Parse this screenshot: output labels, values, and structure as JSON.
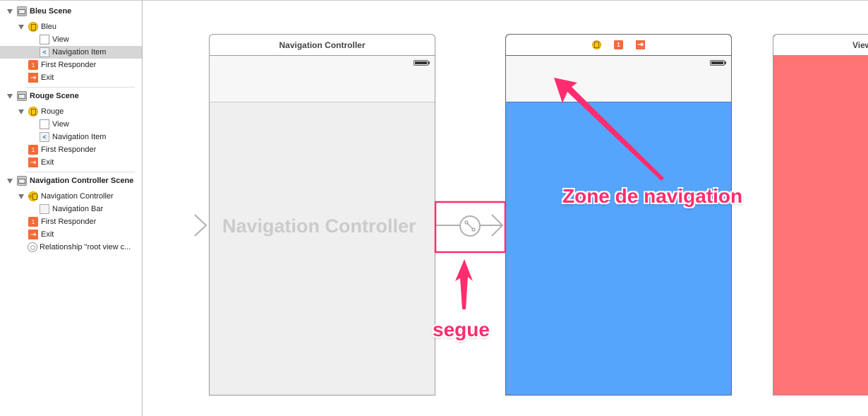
{
  "outline": {
    "scenes": [
      {
        "title": "Bleu Scene",
        "controller": "Bleu",
        "items": [
          "View",
          "Navigation Item"
        ],
        "first_responder": "First Responder",
        "exit": "Exit"
      },
      {
        "title": "Rouge Scene",
        "controller": "Rouge",
        "items": [
          "View",
          "Navigation Item"
        ],
        "first_responder": "First Responder",
        "exit": "Exit"
      },
      {
        "title": "Navigation Controller Scene",
        "controller": "Navigation Controller",
        "items": [
          "Navigation Bar"
        ],
        "first_responder": "First Responder",
        "exit": "Exit",
        "relationship": "Relationship \"root view c..."
      }
    ],
    "selected": "Navigation Item"
  },
  "canvas": {
    "nav_controller": {
      "title": "Navigation Controller",
      "placeholder": "Navigation Controller"
    },
    "bleu_controller": {
      "dock_icons": [
        "view-controller-icon",
        "first-responder-icon",
        "exit-icon"
      ],
      "color": "#55a5fd"
    },
    "rouge_controller": {
      "title": "View",
      "color": "#ff7575"
    }
  },
  "annotations": {
    "navigation_zone": "Zone de navigation",
    "segue": "segue",
    "color": "#ff2d6f"
  }
}
